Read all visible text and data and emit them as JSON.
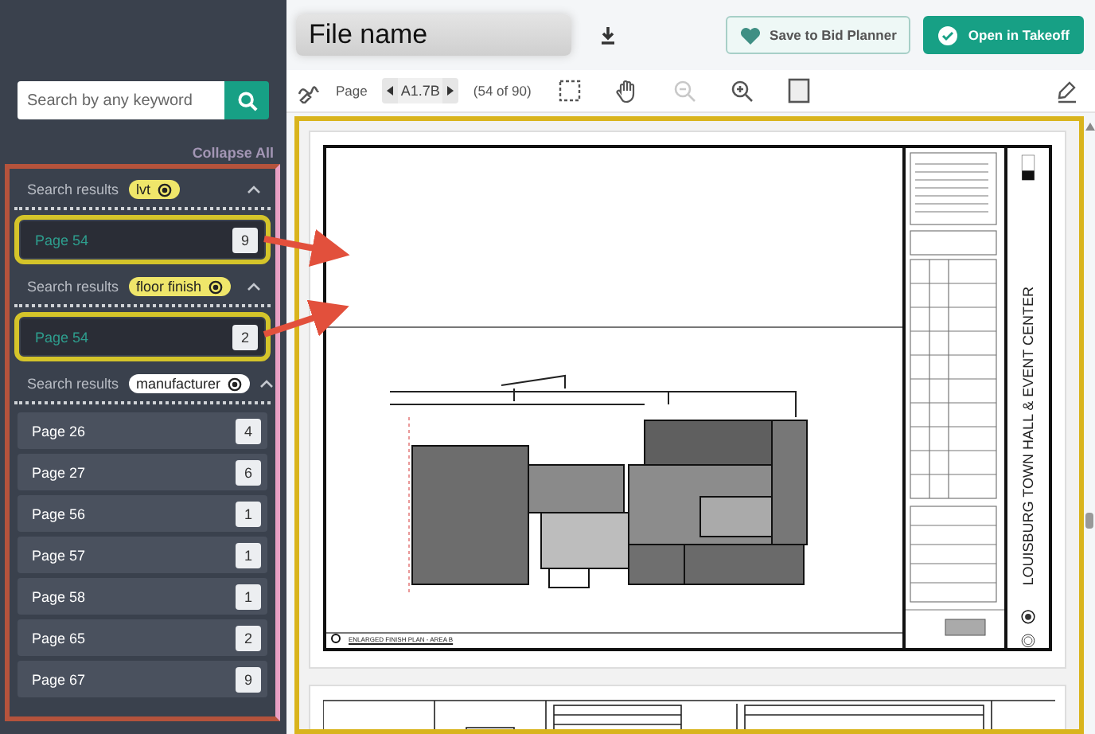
{
  "sidebar": {
    "search": {
      "placeholder": "Search by any keyword"
    },
    "collapse_all": "Collapse All",
    "groups": [
      {
        "label": "Search results",
        "term": "lvt",
        "color": "#efe66a",
        "expanded": true,
        "items": [
          {
            "page": "Page 54",
            "count": "9",
            "selected": true
          }
        ]
      },
      {
        "label": "Search results",
        "term": "floor finish",
        "color": "#efe66a",
        "expanded": true,
        "items": [
          {
            "page": "Page 54",
            "count": "2",
            "selected": true
          }
        ]
      },
      {
        "label": "Search results",
        "term": "manufacturer",
        "color": "#ffffff",
        "expanded": true,
        "items": [
          {
            "page": "Page 26",
            "count": "4",
            "selected": false
          },
          {
            "page": "Page 27",
            "count": "6",
            "selected": false
          },
          {
            "page": "Page 56",
            "count": "1",
            "selected": false
          },
          {
            "page": "Page 57",
            "count": "1",
            "selected": false
          },
          {
            "page": "Page 58",
            "count": "1",
            "selected": false
          },
          {
            "page": "Page 65",
            "count": "2",
            "selected": false
          },
          {
            "page": "Page 67",
            "count": "9",
            "selected": false
          }
        ]
      }
    ]
  },
  "header": {
    "file_name": "File name",
    "buttons": [
      {
        "label": "Save to Bid Planner",
        "kind": "outline"
      },
      {
        "label": "Open in Takeoff",
        "kind": "primary"
      }
    ]
  },
  "toolbar": {
    "tools_before": [
      {
        "kind": "markup",
        "disabled": false
      }
    ],
    "page_label": "Page",
    "sheet": "A1.7B",
    "page_count": "(54 of 90)",
    "tools": [
      {
        "kind": "select",
        "disabled": false
      },
      {
        "kind": "pan",
        "disabled": false
      },
      {
        "kind": "zoom-out",
        "disabled": true
      },
      {
        "kind": "zoom-in",
        "disabled": false
      },
      {
        "kind": "fit-page",
        "disabled": false
      }
    ],
    "tools_end": [
      {
        "kind": "pen",
        "disabled": false
      }
    ]
  },
  "sheet": {
    "drawing_title": "ENLARGED FINISH PLAN - AREA B",
    "project_title": "LOUISBURG TOWN HALL & EVENT CENTER"
  }
}
